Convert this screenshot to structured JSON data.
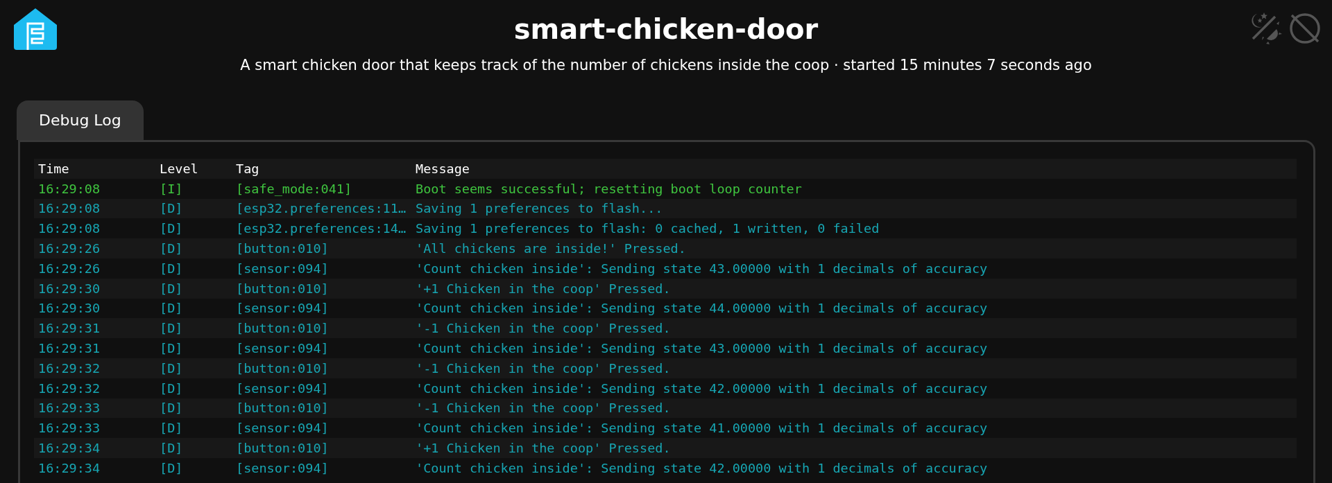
{
  "header": {
    "title": "smart-chicken-door",
    "subtitle": "A smart chicken door that keeps track of the number of chickens inside the coop · started 15 minutes 7 seconds ago"
  },
  "tabs": [
    {
      "label": "Debug Log",
      "selected": true
    }
  ],
  "log": {
    "columns": [
      "Time",
      "Level",
      "Tag",
      "Message"
    ],
    "rows": [
      {
        "kind": "info",
        "time": "16:29:08",
        "severity": "[I]",
        "tag": "[safe_mode:041]",
        "message": "Boot seems successful; resetting boot loop counter"
      },
      {
        "kind": "debug",
        "time": "16:29:08",
        "severity": "[D]",
        "tag": "[esp32.preferences:11…",
        "message": "Saving 1 preferences to flash..."
      },
      {
        "kind": "debug",
        "time": "16:29:08",
        "severity": "[D]",
        "tag": "[esp32.preferences:14…",
        "message": "Saving 1 preferences to flash: 0 cached, 1 written, 0 failed"
      },
      {
        "kind": "debug",
        "time": "16:29:26",
        "severity": "[D]",
        "tag": "[button:010]",
        "message": "'All chickens are inside!' Pressed."
      },
      {
        "kind": "debug",
        "time": "16:29:26",
        "severity": "[D]",
        "tag": "[sensor:094]",
        "message": "'Count chicken inside': Sending state 43.00000 with 1 decimals of accuracy"
      },
      {
        "kind": "debug",
        "time": "16:29:30",
        "severity": "[D]",
        "tag": "[button:010]",
        "message": "'+1 Chicken in the coop' Pressed."
      },
      {
        "kind": "debug",
        "time": "16:29:30",
        "severity": "[D]",
        "tag": "[sensor:094]",
        "message": "'Count chicken inside': Sending state 44.00000 with 1 decimals of accuracy"
      },
      {
        "kind": "debug",
        "time": "16:29:31",
        "severity": "[D]",
        "tag": "[button:010]",
        "message": "'-1 Chicken in the coop' Pressed."
      },
      {
        "kind": "debug",
        "time": "16:29:31",
        "severity": "[D]",
        "tag": "[sensor:094]",
        "message": "'Count chicken inside': Sending state 43.00000 with 1 decimals of accuracy"
      },
      {
        "kind": "debug",
        "time": "16:29:32",
        "severity": "[D]",
        "tag": "[button:010]",
        "message": "'-1 Chicken in the coop' Pressed."
      },
      {
        "kind": "debug",
        "time": "16:29:32",
        "severity": "[D]",
        "tag": "[sensor:094]",
        "message": "'Count chicken inside': Sending state 42.00000 with 1 decimals of accuracy"
      },
      {
        "kind": "debug",
        "time": "16:29:33",
        "severity": "[D]",
        "tag": "[button:010]",
        "message": "'-1 Chicken in the coop' Pressed."
      },
      {
        "kind": "debug",
        "time": "16:29:33",
        "severity": "[D]",
        "tag": "[sensor:094]",
        "message": "'Count chicken inside': Sending state 41.00000 with 1 decimals of accuracy"
      },
      {
        "kind": "debug",
        "time": "16:29:34",
        "severity": "[D]",
        "tag": "[button:010]",
        "message": "'+1 Chicken in the coop' Pressed."
      },
      {
        "kind": "debug",
        "time": "16:29:34",
        "severity": "[D]",
        "tag": "[sensor:094]",
        "message": "'Count chicken inside': Sending state 42.00000 with 1 decimals of accuracy"
      }
    ]
  }
}
